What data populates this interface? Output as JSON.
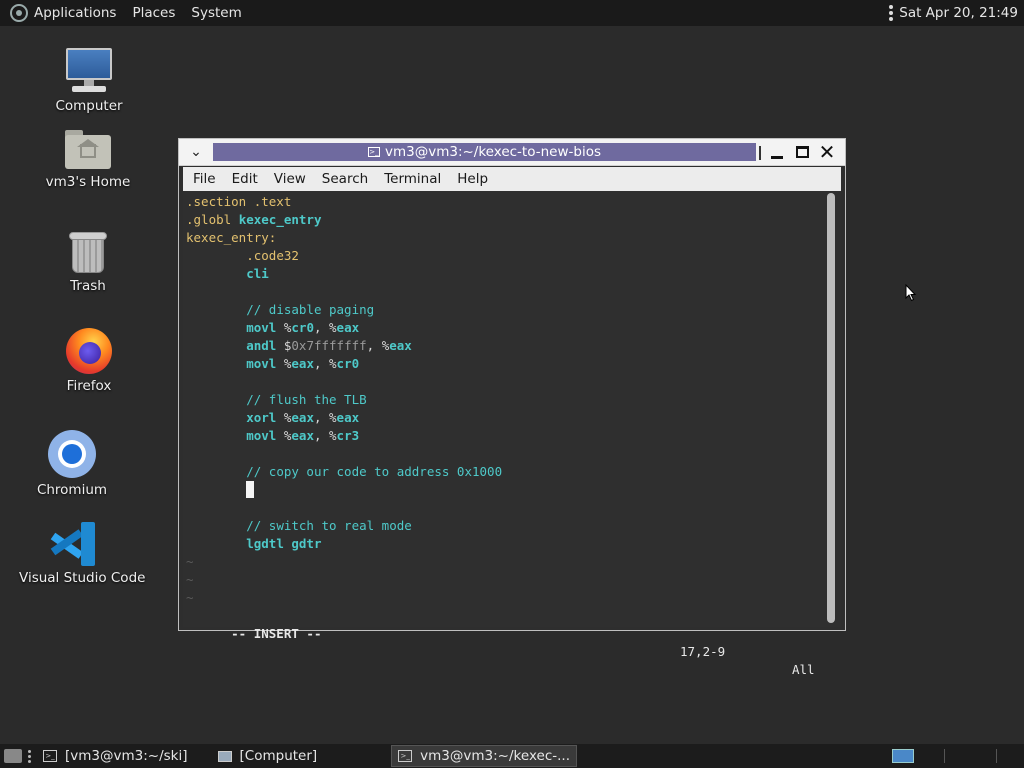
{
  "top_panel": {
    "applications": "Applications",
    "places": "Places",
    "system": "System",
    "clock": "Sat Apr 20, 21:49"
  },
  "desktop_icons": [
    {
      "label": "Computer",
      "icon": "computer-icon"
    },
    {
      "label": "vm3's Home",
      "icon": "home-folder-icon"
    },
    {
      "label": "Trash",
      "icon": "trash-icon"
    },
    {
      "label": "Firefox",
      "icon": "firefox-icon"
    },
    {
      "label": "Chromium",
      "icon": "chromium-icon"
    },
    {
      "label": "Visual Studio Code",
      "icon": "vscode-icon"
    }
  ],
  "terminal": {
    "title": "vm3@vm3:~/kexec-to-new-bios",
    "menu": [
      "File",
      "Edit",
      "View",
      "Search",
      "Terminal",
      "Help"
    ],
    "code_lines": [
      [
        {
          "t": ".section .text",
          "c": "c-dir"
        }
      ],
      [
        {
          "t": ".globl ",
          "c": "c-dir"
        },
        {
          "t": "kexec_entry",
          "c": "c-ins"
        }
      ],
      [
        {
          "t": "kexec_entry:",
          "c": "c-lbl"
        }
      ],
      [
        {
          "t": "        ",
          "c": "c-txt"
        },
        {
          "t": ".code32",
          "c": "c-dir"
        }
      ],
      [
        {
          "t": "        ",
          "c": "c-txt"
        },
        {
          "t": "cli",
          "c": "c-ins"
        }
      ],
      [
        {
          "t": "",
          "c": "c-txt"
        }
      ],
      [
        {
          "t": "        ",
          "c": "c-txt"
        },
        {
          "t": "// disable paging",
          "c": "c-com"
        }
      ],
      [
        {
          "t": "        ",
          "c": "c-txt"
        },
        {
          "t": "movl ",
          "c": "c-ins"
        },
        {
          "t": "%",
          "c": "c-txt"
        },
        {
          "t": "cr0",
          "c": "c-ins"
        },
        {
          "t": ", %",
          "c": "c-txt"
        },
        {
          "t": "eax",
          "c": "c-ins"
        }
      ],
      [
        {
          "t": "        ",
          "c": "c-txt"
        },
        {
          "t": "andl ",
          "c": "c-ins"
        },
        {
          "t": "$",
          "c": "c-txt"
        },
        {
          "t": "0x7fffffff",
          "c": "c-num"
        },
        {
          "t": ", %",
          "c": "c-txt"
        },
        {
          "t": "eax",
          "c": "c-ins"
        }
      ],
      [
        {
          "t": "        ",
          "c": "c-txt"
        },
        {
          "t": "movl ",
          "c": "c-ins"
        },
        {
          "t": "%",
          "c": "c-txt"
        },
        {
          "t": "eax",
          "c": "c-ins"
        },
        {
          "t": ", %",
          "c": "c-txt"
        },
        {
          "t": "cr0",
          "c": "c-ins"
        }
      ],
      [
        {
          "t": "",
          "c": "c-txt"
        }
      ],
      [
        {
          "t": "        ",
          "c": "c-txt"
        },
        {
          "t": "// flush the TLB",
          "c": "c-com"
        }
      ],
      [
        {
          "t": "        ",
          "c": "c-txt"
        },
        {
          "t": "xorl ",
          "c": "c-ins"
        },
        {
          "t": "%",
          "c": "c-txt"
        },
        {
          "t": "eax",
          "c": "c-ins"
        },
        {
          "t": ", %",
          "c": "c-txt"
        },
        {
          "t": "eax",
          "c": "c-ins"
        }
      ],
      [
        {
          "t": "        ",
          "c": "c-txt"
        },
        {
          "t": "movl ",
          "c": "c-ins"
        },
        {
          "t": "%",
          "c": "c-txt"
        },
        {
          "t": "eax",
          "c": "c-ins"
        },
        {
          "t": ", %",
          "c": "c-txt"
        },
        {
          "t": "cr3",
          "c": "c-ins"
        }
      ],
      [
        {
          "t": "",
          "c": "c-txt"
        }
      ],
      [
        {
          "t": "        ",
          "c": "c-txt"
        },
        {
          "t": "// copy our code to address 0x1000",
          "c": "c-com"
        }
      ],
      [
        {
          "t": "        ",
          "c": "c-txt"
        },
        {
          "t": "CURSOR",
          "c": "cursor"
        }
      ],
      [
        {
          "t": "",
          "c": "c-txt"
        }
      ],
      [
        {
          "t": "        ",
          "c": "c-txt"
        },
        {
          "t": "// switch to real mode",
          "c": "c-com"
        }
      ],
      [
        {
          "t": "        ",
          "c": "c-txt"
        },
        {
          "t": "lgdtl gdtr",
          "c": "c-ins"
        }
      ],
      [
        {
          "t": "~",
          "c": "c-tilde"
        }
      ],
      [
        {
          "t": "~",
          "c": "c-tilde"
        }
      ],
      [
        {
          "t": "~",
          "c": "c-tilde"
        }
      ]
    ],
    "status": {
      "mode": "-- INSERT --",
      "position": "17,2-9",
      "scroll": "All"
    }
  },
  "taskbar": {
    "tasks": [
      {
        "label": "[vm3@vm3:~/ski]",
        "icon": "terminal-icon",
        "active": false
      },
      {
        "label": "[Computer]",
        "icon": "computer-icon",
        "active": false
      },
      {
        "label": "vm3@vm3:~/kexec-...",
        "icon": "terminal-icon",
        "active": true
      }
    ]
  },
  "colors": {
    "title_strip": "#6f6a9f",
    "code_keyword": "#4ec9c9",
    "code_directive": "#e3c16f"
  }
}
